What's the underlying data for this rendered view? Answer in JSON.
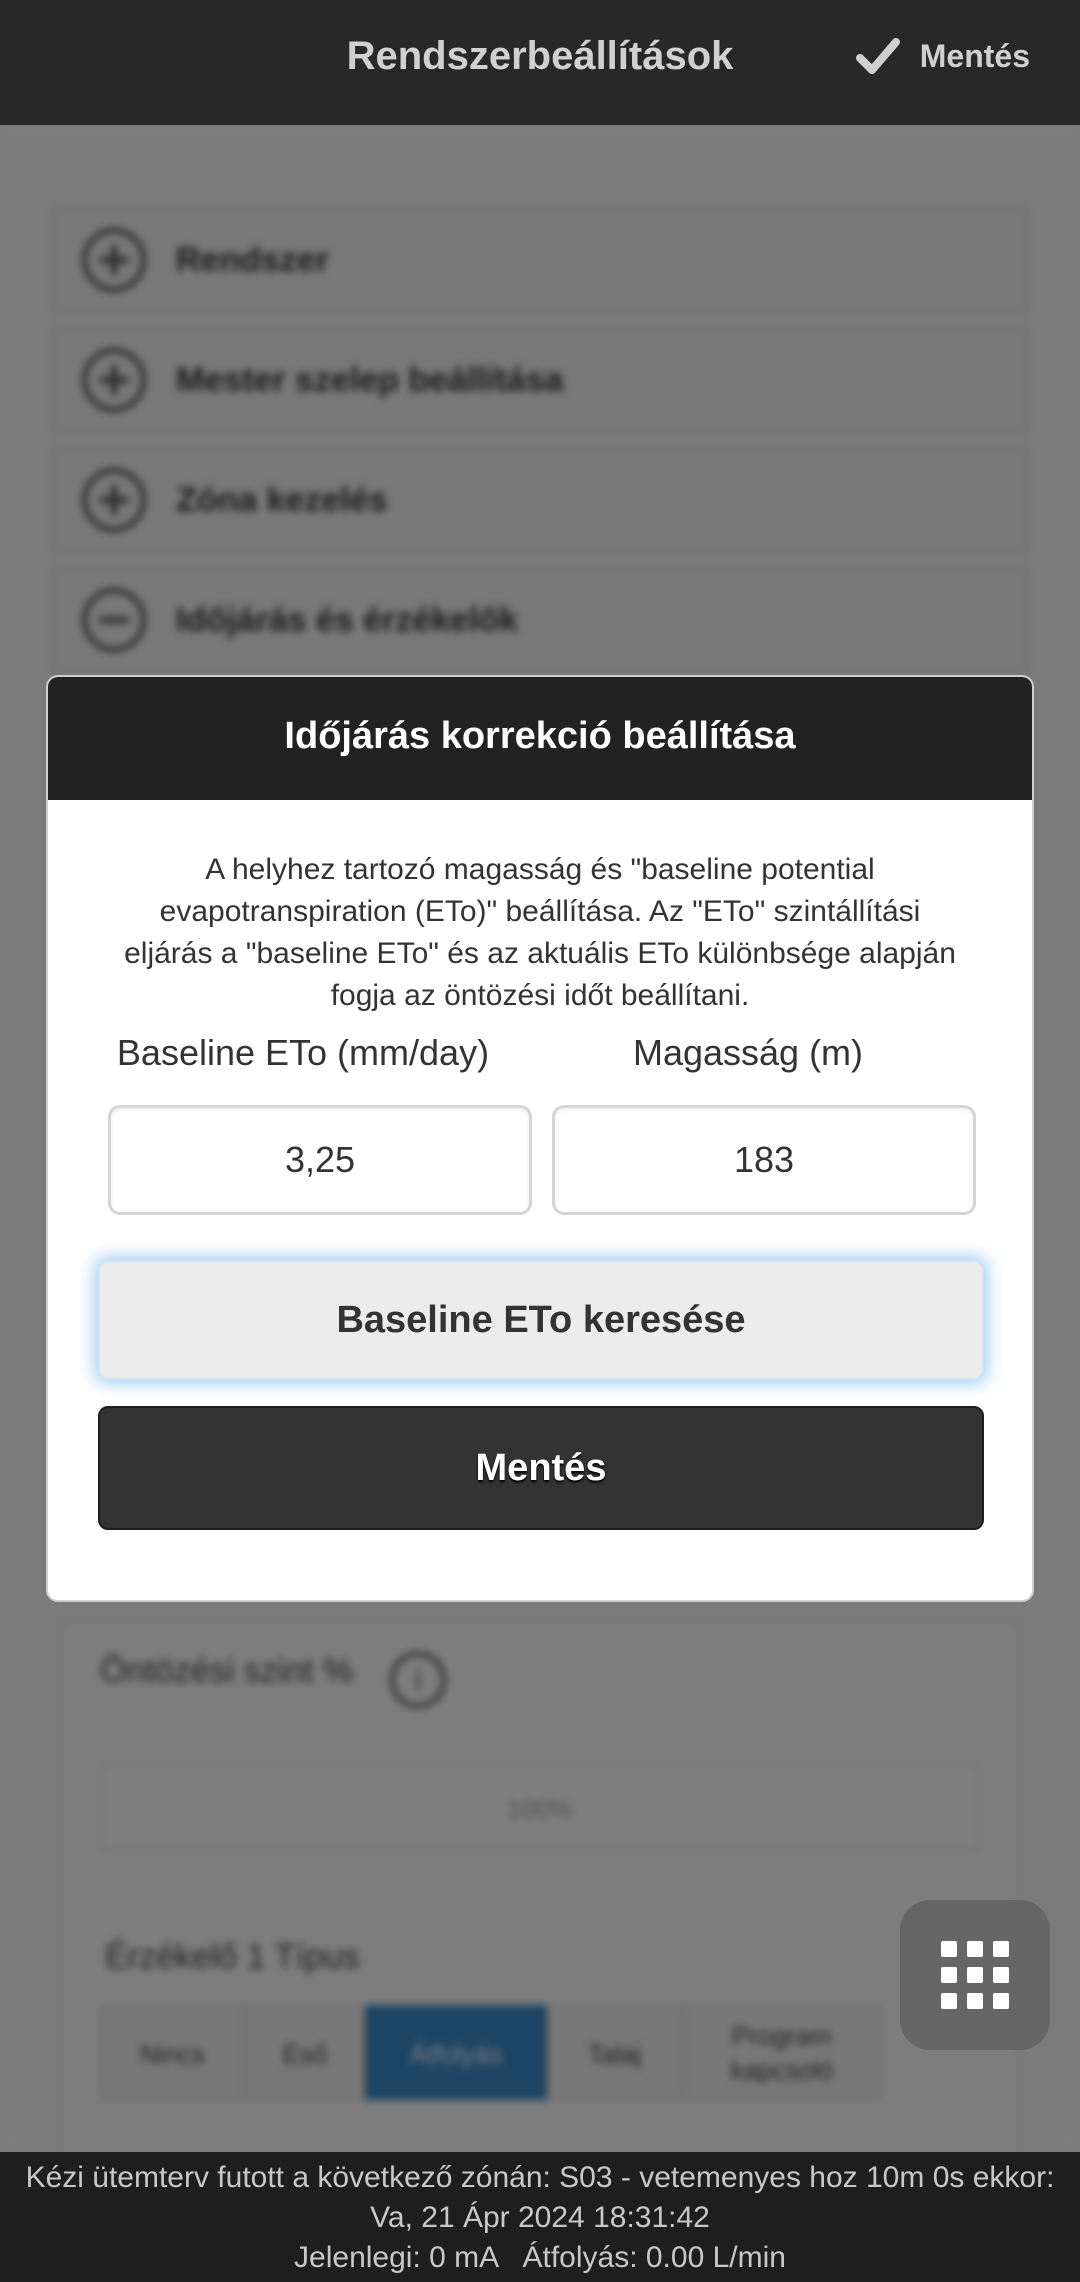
{
  "header": {
    "title": "Rendszerbeállítások",
    "save_label": "Mentés",
    "save_icon": "check-icon"
  },
  "background": {
    "accordion": [
      {
        "label": "Rendszer",
        "icon": "plus-circle-icon"
      },
      {
        "label": "Mester szelep beállítása",
        "icon": "plus-circle-icon"
      },
      {
        "label": "Zóna kezelés",
        "icon": "plus-circle-icon"
      },
      {
        "label": "Időjárás és érzékelők",
        "icon": "minus-circle-icon"
      }
    ],
    "watering_level_label": "Öntözési szint %",
    "watering_level_value": "100%",
    "sensor1_type_label": "Érzékelő 1 Típus",
    "sensor_types": [
      "Nincs",
      "Eső",
      "Átfolyás",
      "Talaj",
      "Program kapcsoló"
    ],
    "sensor_selected": "Átfolyás"
  },
  "modal": {
    "title": "Időjárás korrekció beállítása",
    "description": "A helyhez tartozó magasság és \"baseline potential evapotranspiration (ETo)\" beállítása. Az \"ETo\" szintállítási eljárás a \"baseline ETo\" és az aktuális ETo különbsége alapján fogja az öntözési időt beállítani.",
    "eto_label": "Baseline ETo (mm/day)",
    "eto_value": "3,25",
    "elevation_label": "Magasság (m)",
    "elevation_value": "183",
    "find_button": "Baseline ETo keresése",
    "save_button": "Mentés"
  },
  "fab": {
    "icon": "grid-icon"
  },
  "footer": {
    "line1": "Kézi ütemterv futott a következő zónán: S03 - vetemenyes hoz 10m 0s ekkor:",
    "line2": "Va, 21 Ápr 2024 18:31:42",
    "line3": "Jelenlegi: 0 mA   Átfolyás: 0.00 L/min"
  }
}
